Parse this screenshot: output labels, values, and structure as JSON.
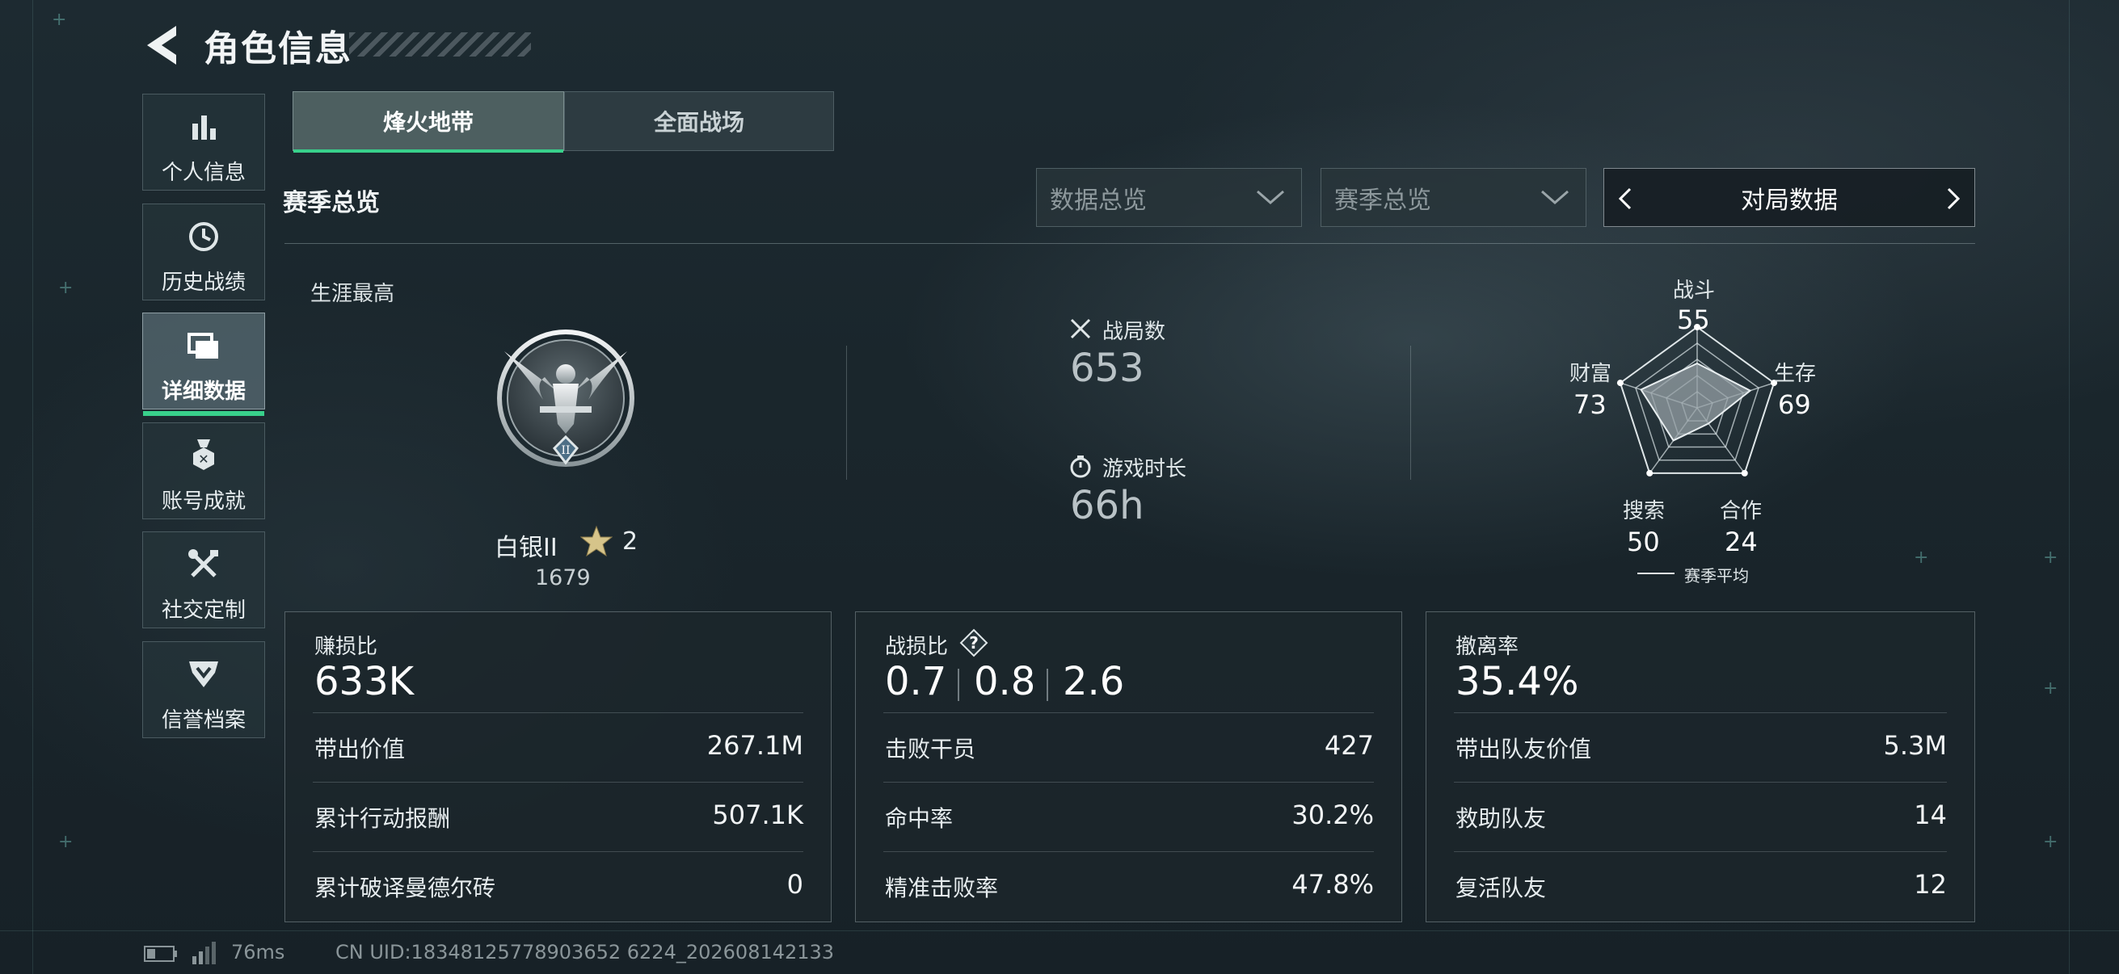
{
  "header": {
    "title": "角色信息",
    "back_icon": "back-arrow-icon"
  },
  "sidebar": {
    "items": [
      {
        "label": "个人信息",
        "icon": "bar-chart-icon"
      },
      {
        "label": "历史战绩",
        "icon": "clock-history-icon"
      },
      {
        "label": "详细数据",
        "icon": "stacked-cards-icon",
        "active": true
      },
      {
        "label": "账号成就",
        "icon": "medal-icon"
      },
      {
        "label": "社交定制",
        "icon": "tools-icon"
      },
      {
        "label": "信誉档案",
        "icon": "shield-badge-icon"
      }
    ]
  },
  "tabs": [
    {
      "label": "烽火地带",
      "active": true
    },
    {
      "label": "全面战场",
      "active": false
    }
  ],
  "section": {
    "title": "赛季总览"
  },
  "filters": {
    "dropdown_1": "数据总览",
    "dropdown_2": "赛季总览",
    "selector": "对局数据"
  },
  "overview": {
    "career_label": "生涯最高",
    "rank_name": "白银II",
    "rank_stars": "2",
    "rank_score": "1679",
    "matches_label": "战局数",
    "matches_value": "653",
    "playtime_label": "游戏时长",
    "playtime_value": "66h"
  },
  "radar": {
    "stats": [
      {
        "name": "战斗",
        "value": 55
      },
      {
        "name": "生存",
        "value": 69
      },
      {
        "name": "合作",
        "value": 24
      },
      {
        "name": "搜索",
        "value": 50
      },
      {
        "name": "财富",
        "value": 73
      }
    ],
    "legend": "赛季平均"
  },
  "cards": {
    "profit": {
      "title": "赚损比",
      "value": "633K",
      "rows": [
        {
          "label": "带出价值",
          "value": "267.1M"
        },
        {
          "label": "累计行动报酬",
          "value": "507.1K"
        },
        {
          "label": "累计破译曼德尔砖",
          "value": "0"
        }
      ]
    },
    "kd": {
      "title": "战损比",
      "values": [
        "0.7",
        "0.8",
        "2.6"
      ],
      "rows": [
        {
          "label": "击败干员",
          "value": "427"
        },
        {
          "label": "命中率",
          "value": "30.2%"
        },
        {
          "label": "精准击败率",
          "value": "47.8%"
        }
      ]
    },
    "extract": {
      "title": "撤离率",
      "value": "35.4%",
      "rows": [
        {
          "label": "带出队友价值",
          "value": "5.3M"
        },
        {
          "label": "救助队友",
          "value": "14"
        },
        {
          "label": "复活队友",
          "value": "12"
        }
      ]
    }
  },
  "footer": {
    "ping": "76ms",
    "uid": "CN UID:18348125778903652 6224_202608142133"
  },
  "colors": {
    "accent": "#38d08b",
    "background": "#1b272d"
  }
}
